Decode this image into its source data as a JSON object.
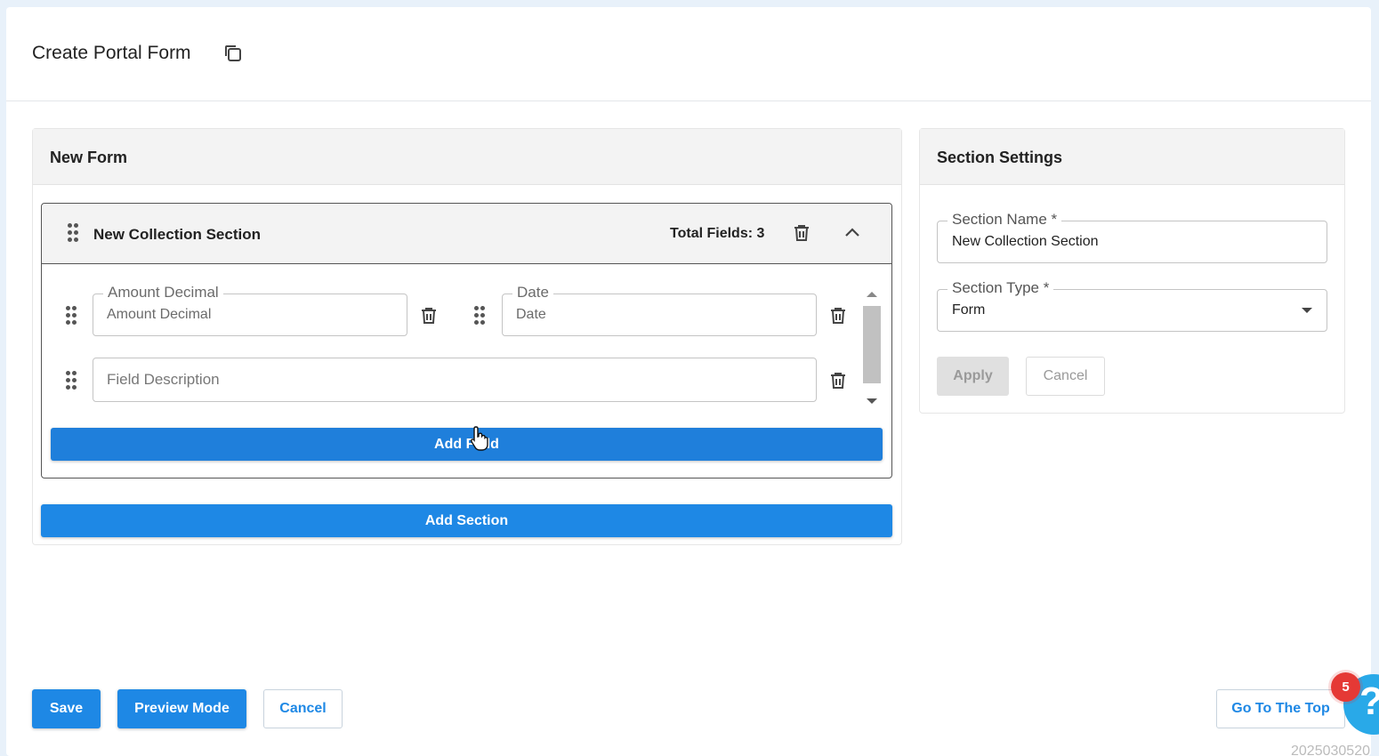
{
  "header": {
    "title": "Create Portal Form",
    "copy_icon": "copy-icon"
  },
  "form_panel": {
    "title": "New Form",
    "section": {
      "name": "New Collection Section",
      "total_fields": "Total Fields: 3",
      "fields": [
        {
          "label": "Amount Decimal",
          "value": "Amount Decimal"
        },
        {
          "label": "Date",
          "value": "Date"
        },
        {
          "placeholder": "Field Description"
        }
      ],
      "add_field_label": "Add Field"
    },
    "add_section_label": "Add Section"
  },
  "settings_panel": {
    "title": "Section Settings",
    "section_name": {
      "label": "Section Name *",
      "value": "New Collection Section"
    },
    "section_type": {
      "label": "Section Type *",
      "value": "Form"
    },
    "apply_label": "Apply",
    "cancel_label": "Cancel"
  },
  "footer": {
    "save_label": "Save",
    "preview_label": "Preview Mode",
    "cancel_label": "Cancel",
    "go_top_label": "Go To The Top"
  },
  "help": {
    "badge_count": "5",
    "symbol": "?"
  },
  "version_text": "2025030520",
  "colors": {
    "primary": "#1e88e5",
    "badge": "#e53935",
    "help": "#29a9e8"
  }
}
